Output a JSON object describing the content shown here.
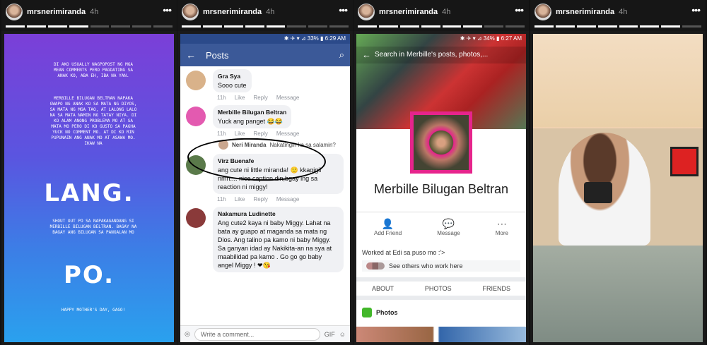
{
  "stories": [
    {
      "username": "mrsnerimiranda",
      "time": "4h"
    },
    {
      "username": "mrsnerimiranda",
      "time": "4h"
    },
    {
      "username": "mrsnerimiranda",
      "time": "4h"
    },
    {
      "username": "mrsnerimiranda",
      "time": "4h"
    }
  ],
  "menu_dots": "•••",
  "story1": {
    "text1": "DI AKO USUALLY NAGPOPOST NG MGA MEAN COMMENTS PERO PAGDATING SA ANAK KO, ABA EH, IBA NA YAN.",
    "text2": "MERBILLE BILUGAN BELTRAN NAPAKA GWAPO NG ANAK KO SA MATA NG DIYOS, SA MATA NG MGA TAO, AT LALONG LALO NA SA MATA NAMIN NG TATAY NIYA. DI KO ALAM ANONG PROBLEMA MO AT SA MATA MO PERO DI KO GUSTO SA PAGHA YUCK NO COMMENT MO. AT DI KO RIN PUPUNAIN ANG ANAK MO AT ASAWA MO. IKAW NA",
    "big1": "LANG.",
    "text3": "SHOUT OUT PO SA NAPAKAGANDANG SI MERBILLE BILUGAN BELTRAN. BAGAY NA BAGAY ANG BILUGAN SA PANGALAN MO",
    "big2": "PO.",
    "text4": "HAPPY MOTHER'S DAY, GAGO!"
  },
  "story2": {
    "status": "✱ ✈ ▾ ⊿ 33% ▮ 6:29 AM",
    "back": "←",
    "title": "Posts",
    "search": "⌕",
    "comments": [
      {
        "name": "Gra Sya",
        "text": "Sooo cute",
        "time": "11h",
        "like": "Like",
        "reply": "Reply",
        "message": "Message"
      },
      {
        "name": "Merbille Bilugan Beltran",
        "text": "Yuck ang panget 😂😂",
        "time": "11h",
        "like": "Like",
        "reply": "Reply",
        "message": "Message"
      },
      {
        "name": "Virz Buenafe",
        "text": "ang cute ni little miranda! 🙂 kkagigil nmn.... nice caption din,bgay lng sa reaction ni miggy!",
        "time": "11h",
        "like": "Like",
        "reply": "Reply",
        "message": "Message"
      },
      {
        "name": "Nakamura Ludinette",
        "text": "Ang cute2 kaya ni baby Miggy. Lahat na bata ay guapo at maganda sa mata ng Dios. Ang talino pa kamo ni baby Miggy. Sa ganyan idad ay Nakikita-an na sya at maabilidad pa kamo . Go go go baby angel Miggy ! ❤😘"
      }
    ],
    "reply": {
      "name": "Neri Miranda",
      "text": "Nakatingin ka sa salamin?"
    },
    "compose": "Write a comment...",
    "gif": "GIF",
    "camera": "◎",
    "emoji": "☺"
  },
  "story3": {
    "status": "✱ ✈ ▾ ⊿ 34% ▮ 6:27 AM",
    "search": "Search in Merbille's posts, photos,...",
    "back": "←",
    "name": "Merbille Bilugan Beltran",
    "actions": [
      {
        "icon": "👤",
        "label": "Add Friend"
      },
      {
        "icon": "💬",
        "label": "Message"
      },
      {
        "icon": "⋯",
        "label": "More"
      }
    ],
    "work_prefix": "Worked at ",
    "work_place": "Edi sa puso mo :'>",
    "see_others": "See others who work here",
    "tabs": [
      "ABOUT",
      "PHOTOS",
      "FRIENDS"
    ],
    "photos": "Photos"
  }
}
